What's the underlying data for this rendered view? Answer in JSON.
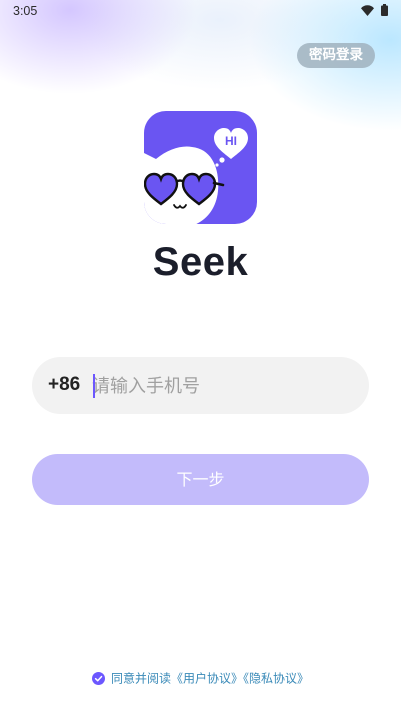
{
  "status_bar": {
    "time": "3:05",
    "icons": [
      "wifi-icon",
      "battery-icon"
    ]
  },
  "header": {
    "password_login_label": "密码登录"
  },
  "logo": {
    "bubble_text": "HI",
    "icon": "cat-with-heart-glasses-logo"
  },
  "app_name": "Seek",
  "phone_form": {
    "country_code": "+86",
    "placeholder": "请输入手机号",
    "value": ""
  },
  "next_button_label": "下一步",
  "agreement": {
    "checked": true,
    "prefix": "同意并阅读",
    "user_agreement": "《用户协议》",
    "privacy_policy": "《隐私协议》"
  },
  "colors": {
    "accent": "#6C57FF",
    "button_disabled": "#C3BBFB",
    "link": "#3A8AB8",
    "title": "#1B1E2B"
  }
}
